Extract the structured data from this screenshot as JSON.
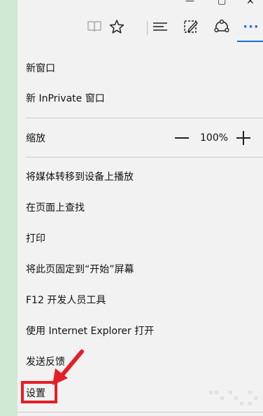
{
  "icons": {
    "minimize": "minimize-icon",
    "maximize": "maximize-icon",
    "close": "close-icon",
    "reading_view": "reading-view-icon",
    "favorites": "star-icon",
    "hub": "hub-icon",
    "web_note": "web-note-icon",
    "share": "share-icon",
    "more": "more-icon"
  },
  "colors": {
    "accent": "#1c6fd1",
    "highlight": "#e41e26",
    "left_strip": "#cfe8d3"
  },
  "window_controls": {
    "minimize": "—",
    "maximize": "▢",
    "close": "✕"
  },
  "toolbar": {
    "more": "···"
  },
  "menu": {
    "new_window": "新窗口",
    "new_inprivate": "新 InPrivate 窗口",
    "zoom_label": "缩放",
    "zoom_value": "100%",
    "cast": "将媒体转移到设备上播放",
    "find": "在页面上查找",
    "print": "打印",
    "pin": "将此页固定到“开始”屏幕",
    "devtools": "F12 开发人员工具",
    "open_ie": "使用 Internet Explorer 打开",
    "feedback": "发送反馈",
    "settings": "设置"
  }
}
